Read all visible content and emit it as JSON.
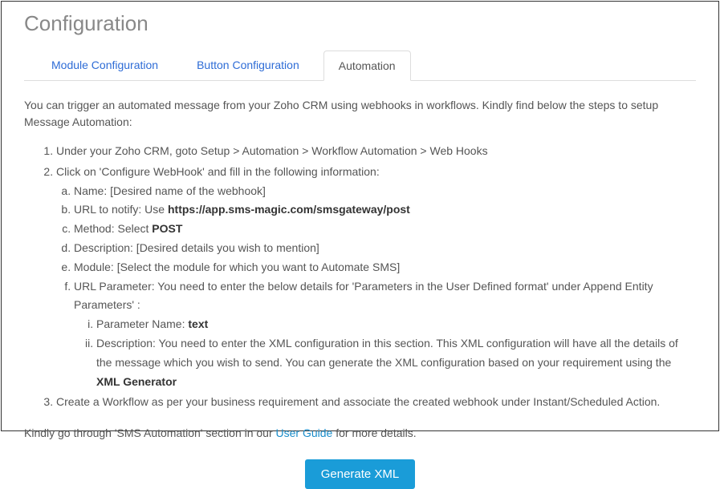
{
  "page": {
    "title": "Configuration"
  },
  "tabs": {
    "module": "Module Configuration",
    "button": "Button Configuration",
    "automation": "Automation"
  },
  "content": {
    "intro": "You can trigger an automated message from your Zoho CRM using webhooks in workflows. Kindly find below the steps to setup Message Automation:",
    "step1": "Under your Zoho CRM, goto Setup > Automation > Workflow Automation > Web Hooks",
    "step2": "Click on 'Configure WebHook' and fill in the following information:",
    "sub": {
      "a": "Name: [Desired name of the webhook]",
      "b_pre": "URL to notify: Use ",
      "b_bold": "https://app.sms-magic.com/smsgateway/post",
      "c_pre": "Method: Select ",
      "c_bold": "POST",
      "d": "Description: [Desired details you wish to mention]",
      "e": "Module: [Select the module for which you want to Automate SMS]",
      "f": "URL Parameter: You need to enter the below details for 'Parameters in the User Defined format' under Append Entity Parameters' :",
      "inner_i_pre": "Parameter Name: ",
      "inner_i_bold": "text",
      "inner_ii_pre": "Description: You need to enter the XML configuration in this section. This XML configuration will have all the details of the message which you wish to send. You can generate the XML configuration based on your requirement using the ",
      "inner_ii_bold": "XML Generator"
    },
    "step3": "Create a Workflow as per your business requirement and associate the created webhook under Instant/Scheduled Action.",
    "footer_pre": "Kindly go through 'SMS Automation' section in our ",
    "footer_link": "User Guide",
    "footer_post": " for more details.",
    "button": "Generate XML"
  }
}
